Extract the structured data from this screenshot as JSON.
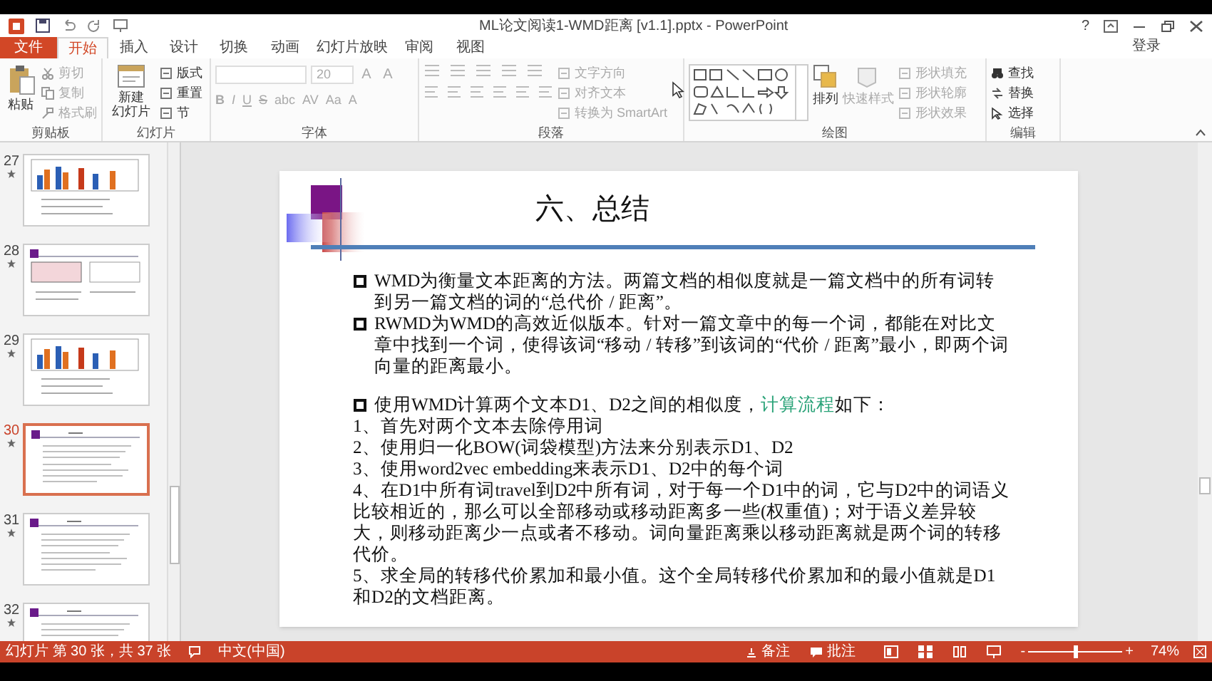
{
  "window": {
    "title": "ML论文阅读1-WMD距离 [v1.1].pptx - PowerPoint",
    "help": "?",
    "sign_in": "登录"
  },
  "tabs": [
    {
      "label": "文件",
      "selected": false,
      "kind": "file"
    },
    {
      "label": "开始",
      "selected": true,
      "kind": "tab"
    },
    {
      "label": "插入",
      "selected": false,
      "kind": "tab"
    },
    {
      "label": "设计",
      "selected": false,
      "kind": "tab"
    },
    {
      "label": "切换",
      "selected": false,
      "kind": "tab"
    },
    {
      "label": "动画",
      "selected": false,
      "kind": "tab"
    },
    {
      "label": "幻灯片放映",
      "selected": false,
      "kind": "tab"
    },
    {
      "label": "审阅",
      "selected": false,
      "kind": "tab"
    },
    {
      "label": "视图",
      "selected": false,
      "kind": "tab"
    }
  ],
  "ribbon": {
    "clipboard": {
      "label": "剪贴板",
      "paste": {
        "label": "粘贴",
        "disabled": false
      },
      "items": [
        {
          "label": "剪切",
          "disabled": true
        },
        {
          "label": "复制",
          "disabled": true
        },
        {
          "label": "格式刷",
          "disabled": true
        }
      ]
    },
    "slides": {
      "label": "幻灯片",
      "new_slide": {
        "lines": [
          "新建",
          "幻灯片"
        ],
        "disabled": false
      },
      "items": [
        {
          "label": "版式",
          "disabled": false
        },
        {
          "label": "重置",
          "disabled": false
        },
        {
          "label": "节",
          "disabled": false
        }
      ]
    },
    "font": {
      "label": "字体",
      "size": "20",
      "disabled": true,
      "row1": [
        "A",
        "A"
      ],
      "row2": [
        "B",
        "I",
        "U",
        "S",
        "abc",
        "AV",
        "Aa",
        "A"
      ]
    },
    "paragraph": {
      "label": "段落",
      "disabled": true,
      "items": [
        {
          "label": "文字方向"
        },
        {
          "label": "对齐文本"
        },
        {
          "label": "转换为 SmartArt"
        }
      ]
    },
    "drawing": {
      "label": "绘图",
      "arrange": {
        "label": "排列",
        "disabled": false
      },
      "quick_styles": {
        "label": "快速样式",
        "disabled": true
      },
      "items": [
        {
          "label": "形状填充",
          "disabled": true
        },
        {
          "label": "形状轮廓",
          "disabled": true
        },
        {
          "label": "形状效果",
          "disabled": true
        }
      ]
    },
    "editing": {
      "label": "编辑",
      "items": [
        {
          "label": "查找",
          "disabled": false
        },
        {
          "label": "替换",
          "disabled": false
        },
        {
          "label": "选择",
          "disabled": false
        }
      ]
    }
  },
  "thumbnails": [
    {
      "number": "27",
      "selected": false,
      "kind": "chart"
    },
    {
      "number": "28",
      "selected": false,
      "kind": "images"
    },
    {
      "number": "29",
      "selected": false,
      "kind": "chart"
    },
    {
      "number": "30",
      "selected": true,
      "kind": "text"
    },
    {
      "number": "31",
      "selected": false,
      "kind": "text"
    },
    {
      "number": "32",
      "selected": false,
      "kind": "text"
    }
  ],
  "slide": {
    "title": "六、总结",
    "paragraphs": [
      {
        "kind": "bullet",
        "segments": [
          {
            "text": "WMD为衡量文本距离的方法。两篇文档的相似度就是一篇文档中的所有词转到另一篇文档的词的“总代价 / 距离”。",
            "emphasis": false
          }
        ]
      },
      {
        "kind": "bullet",
        "segments": [
          {
            "text": "RWMD为WMD的高效近似版本。针对一篇文章中的每一个词，都能在对比文章中找到一个词，使得该词“移动 / 转移”到该词的“代价 / 距离”最小，即两个词向量的距离最小。",
            "emphasis": false
          }
        ]
      },
      {
        "kind": "blank"
      },
      {
        "kind": "bullet",
        "segments": [
          {
            "text": "使用WMD计算两个文本D1、D2之间的相似度，",
            "emphasis": false
          },
          {
            "text": "计算流程",
            "emphasis": true
          },
          {
            "text": "如下：",
            "emphasis": false
          }
        ]
      },
      {
        "kind": "plain",
        "segments": [
          {
            "text": "1、首先对两个文本去除停用词",
            "emphasis": false
          }
        ]
      },
      {
        "kind": "plain",
        "segments": [
          {
            "text": "2、使用归一化BOW(词袋模型)方法来分别表示D1、D2",
            "emphasis": false
          }
        ]
      },
      {
        "kind": "plain",
        "segments": [
          {
            "text": "3、使用word2vec embedding来表示D1、D2中的每个词",
            "emphasis": false
          }
        ]
      },
      {
        "kind": "plain",
        "segments": [
          {
            "text": "4、在D1中所有词travel到D2中所有词，对于每一个D1中的词，它与D2中的词语义比较相近的，那么可以全部移动或移动距离多一些(权重值)；对于语义差异较大，则移动距离少一点或者不移动。词向量距离乘以移动距离就是两个词的转移代价。",
            "emphasis": false
          }
        ]
      },
      {
        "kind": "plain",
        "segments": [
          {
            "text": "5、求全局的转移代价累加和最小值。这个全局转移代价累加和的最小值就是D1和D2的文档距离。",
            "emphasis": false
          }
        ]
      }
    ]
  },
  "status_bar": {
    "slide_info": "幻灯片 第 30 张，共 37 张",
    "language": "中文(中国)",
    "notes": "备注",
    "comments": "批注",
    "zoom": {
      "minus": "-",
      "plus": "+",
      "level": 0.5,
      "reading": "74%"
    }
  }
}
